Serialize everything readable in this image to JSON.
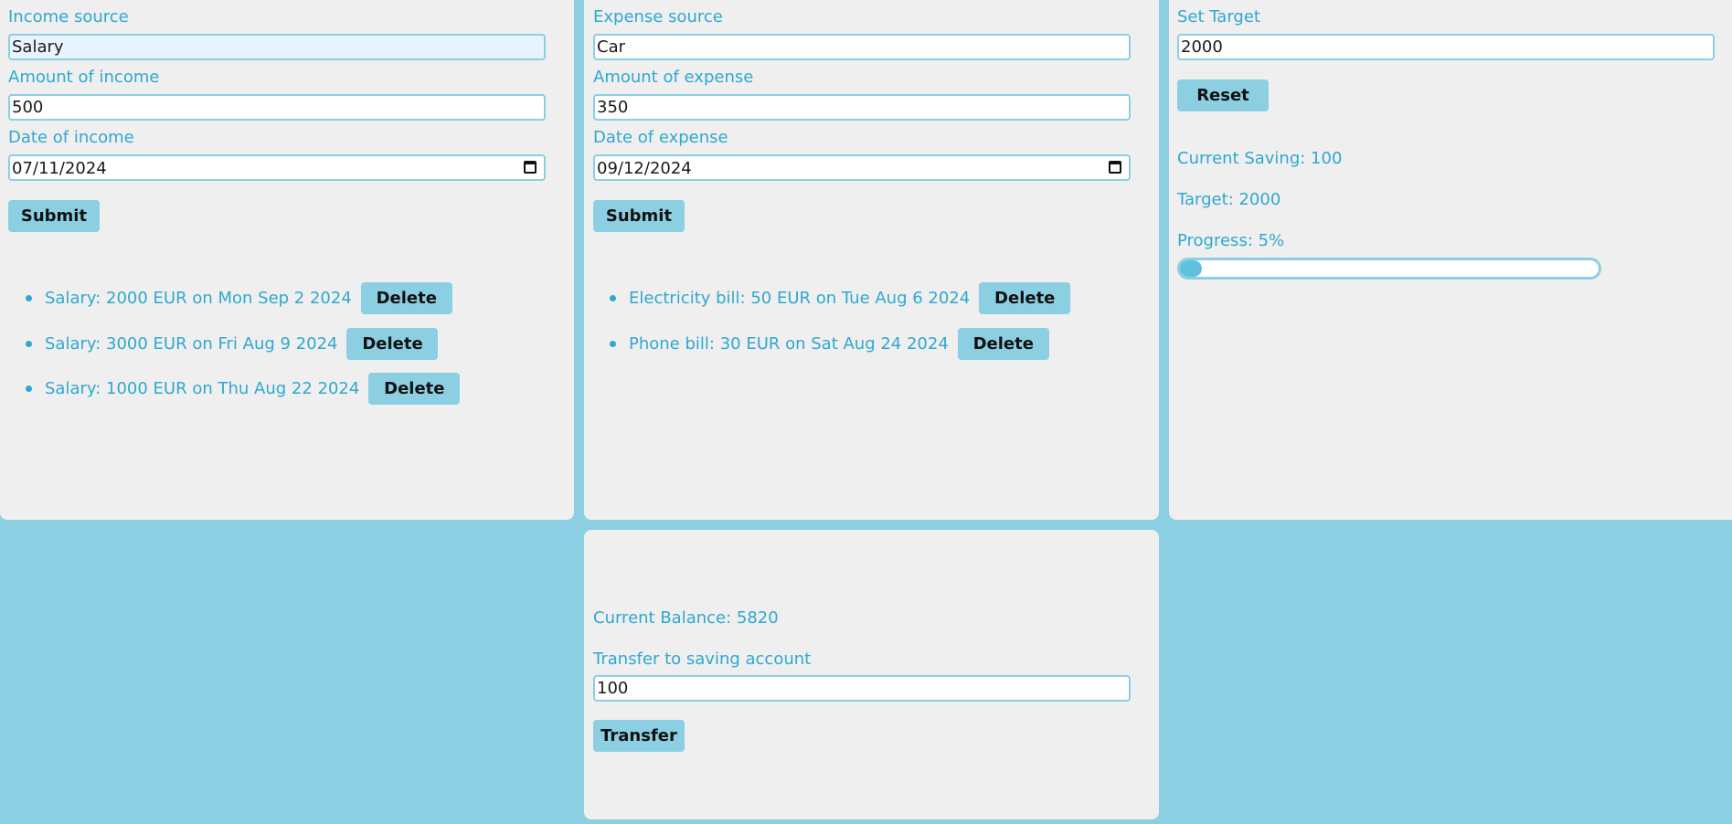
{
  "income": {
    "source_label": "Income source",
    "source_value": "Salary",
    "amount_label": "Amount of income",
    "amount_value": "500",
    "date_label": "Date of income",
    "date_value": "07/11/2024",
    "submit_label": "Submit",
    "items": [
      {
        "text": "Salary: 2000 EUR on Mon Sep 2 2024",
        "delete_label": "Delete"
      },
      {
        "text": "Salary: 3000 EUR on Fri Aug 9 2024",
        "delete_label": "Delete"
      },
      {
        "text": "Salary: 1000 EUR on Thu Aug 22 2024",
        "delete_label": "Delete"
      }
    ]
  },
  "expense": {
    "source_label": "Expense source",
    "source_value": "Car",
    "amount_label": "Amount of expense",
    "amount_value": "350",
    "date_label": "Date of expense",
    "date_value": "09/12/2024",
    "submit_label": "Submit",
    "items": [
      {
        "text": "Electricity bill: 50 EUR on Tue Aug 6 2024",
        "delete_label": "Delete"
      },
      {
        "text": "Phone bill: 30 EUR on Sat Aug 24 2024",
        "delete_label": "Delete"
      }
    ]
  },
  "target": {
    "set_label": "Set Target",
    "set_value": "2000",
    "reset_label": "Reset",
    "current_saving": "Current Saving: 100",
    "target_text": "Target: 2000",
    "progress_text": "Progress: 5%",
    "progress_fraction": 0.05
  },
  "balance": {
    "current_balance": "Current Balance: 5820",
    "transfer_label": "Transfer to saving account",
    "transfer_value": "100",
    "transfer_button": "Transfer"
  },
  "colors": {
    "background": "#8ccfe2",
    "panel": "#efefef",
    "accent_text": "#2fa8cf"
  }
}
